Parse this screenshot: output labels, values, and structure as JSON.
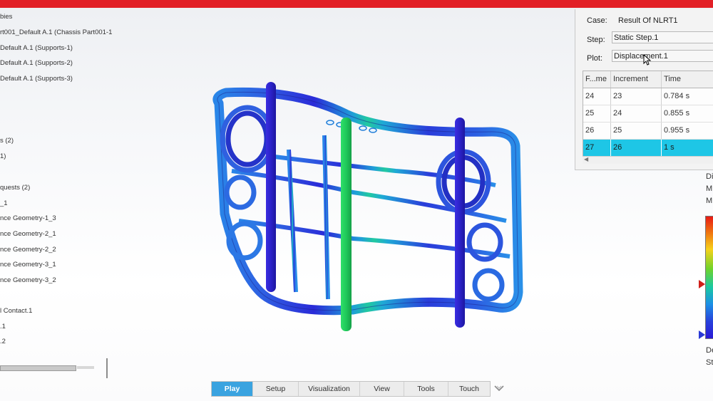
{
  "spec_tree": {
    "items": [
      "bies",
      "rt001_Default A.1 (Chassis Part001-1",
      "Default A.1 (Supports-1)",
      "Default A.1 (Supports-2)",
      "Default A.1 (Supports-3)",
      "s (2)",
      "1)",
      "quests (2)",
      "_1",
      "nce Geometry-1_3",
      "nce Geometry-2_1",
      "nce Geometry-2_2",
      "nce Geometry-3_1",
      "nce Geometry-3_2",
      "l Contact.1",
      ".1",
      ".2"
    ]
  },
  "animation_panel": {
    "case_label": "Case:",
    "case_value": "Result Of NLRT1",
    "step_label": "Step:",
    "step_value": "Static Step.1",
    "plot_label": "Plot:",
    "plot_value": "Displacement.1",
    "table": {
      "columns": [
        "F...me",
        "Increment",
        "Time"
      ],
      "rows": [
        [
          "24",
          "23",
          "0.784 s"
        ],
        [
          "25",
          "24",
          "0.855 s"
        ],
        [
          "26",
          "25",
          "0.955 s"
        ],
        [
          "27",
          "26",
          "1 s"
        ]
      ],
      "selected_row": 3
    }
  },
  "legend": {
    "title_lines": [
      "Di",
      "M",
      "M"
    ],
    "footer_lines": [
      "De",
      "St"
    ]
  },
  "toolbar": {
    "tabs": [
      "Play",
      "Setup",
      "Visualization",
      "View",
      "Tools",
      "Touch"
    ],
    "active_tab": "Play"
  },
  "colors": {
    "title_bar": "#e21f26",
    "selection": "#1ec6e6",
    "active_tab": "#3aa3e0"
  },
  "icons": [
    "collapse-chevron-icon",
    "legend-max-marker-icon",
    "legend-min-marker-icon",
    "mouse-cursor-icon"
  ]
}
